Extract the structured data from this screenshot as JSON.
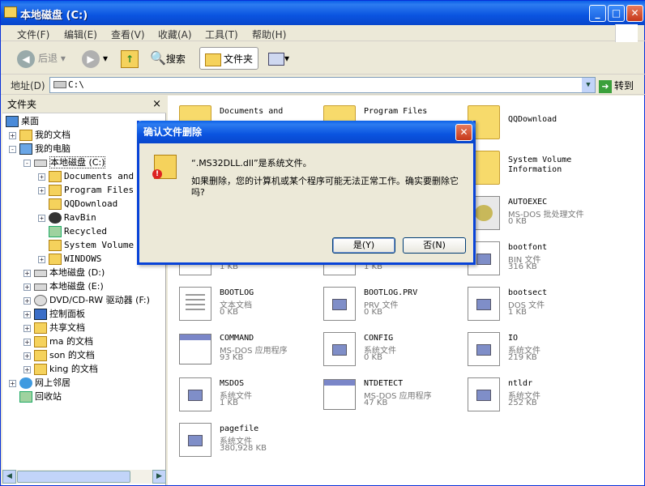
{
  "window": {
    "title": "本地磁盘 (C:)"
  },
  "menu": [
    "文件(F)",
    "编辑(E)",
    "查看(V)",
    "收藏(A)",
    "工具(T)",
    "帮助(H)"
  ],
  "toolbar": {
    "back": "后退",
    "search": "搜索",
    "folders": "文件夹"
  },
  "address": {
    "label": "地址(D)",
    "value": "C:\\",
    "go": "转到"
  },
  "pane": {
    "title": "文件夹",
    "close": "×"
  },
  "tree": [
    {
      "label": "桌面",
      "icon": "desktop-icon"
    },
    {
      "label": "我的文档",
      "icon": "folder-icon"
    },
    {
      "label": "我的电脑",
      "icon": "computer-icon"
    },
    {
      "label": "本地磁盘 (C:)",
      "icon": "drive-icon"
    },
    {
      "label": "Documents and",
      "icon": "folder-icon"
    },
    {
      "label": "Program Files",
      "icon": "folder-icon"
    },
    {
      "label": "QQDownload",
      "icon": "folder-icon"
    },
    {
      "label": "RavBin",
      "icon": "rav-icon"
    },
    {
      "label": "Recycled",
      "icon": "recycle-icon"
    },
    {
      "label": "System Volume",
      "icon": "folder-icon"
    },
    {
      "label": "WINDOWS",
      "icon": "folder-icon"
    },
    {
      "label": "本地磁盘 (D:)",
      "icon": "drive-icon"
    },
    {
      "label": "本地磁盘 (E:)",
      "icon": "drive-icon"
    },
    {
      "label": "DVD/CD-RW 驱动器 (F:)",
      "icon": "cd-icon"
    },
    {
      "label": "控制面板",
      "icon": "control-panel-icon"
    },
    {
      "label": "共享文档",
      "icon": "folder-icon"
    },
    {
      "label": "ma 的文档",
      "icon": "folder-icon"
    },
    {
      "label": "son 的文档",
      "icon": "folder-icon"
    },
    {
      "label": "king 的文档",
      "icon": "folder-icon"
    },
    {
      "label": "网上邻居",
      "icon": "network-icon"
    },
    {
      "label": "回收站",
      "icon": "recycle-bin-icon"
    }
  ],
  "files": [
    {
      "name": "Documents and",
      "type": "",
      "size": "",
      "icon": "folder"
    },
    {
      "name": "Program Files",
      "type": "",
      "size": "",
      "icon": "folder"
    },
    {
      "name": "QQDownload",
      "type": "",
      "size": "",
      "icon": "folder"
    },
    {
      "name": "System Volume",
      "type": "Information",
      "size": "",
      "icon": "folder"
    },
    {
      "name": "AUTOEXEC",
      "type": "MS-DOS 批处理文件",
      "size": "0 KB",
      "icon": "bat"
    },
    {
      "name": "bootfont",
      "type": "BIN 文件",
      "size": "316 KB",
      "icon": "sys"
    },
    {
      "name": "BOOTLOG",
      "type": "文本文档",
      "size": "0 KB",
      "icon": "doc"
    },
    {
      "name": "BOOTLOG.PRV",
      "type": "PRV 文件",
      "size": "0 KB",
      "icon": "sys"
    },
    {
      "name": "bootsect",
      "type": "DOS 文件",
      "size": "1 KB",
      "icon": "sys"
    },
    {
      "name": "COMMAND",
      "type": "MS-DOS 应用程序",
      "size": "93 KB",
      "icon": "app"
    },
    {
      "name": "CONFIG",
      "type": "系统文件",
      "size": "0 KB",
      "icon": "sys"
    },
    {
      "name": "IO",
      "type": "系统文件",
      "size": "219 KB",
      "icon": "sys"
    },
    {
      "name": "MSDOS",
      "type": "系统文件",
      "size": "1 KB",
      "icon": "sys"
    },
    {
      "name": "NTDETECT",
      "type": "MS-DOS 应用程序",
      "size": "47 KB",
      "icon": "app"
    },
    {
      "name": "ntldr",
      "type": "系统文件",
      "size": "252 KB",
      "icon": "sys"
    },
    {
      "name": "pagefile",
      "type": "系统文件",
      "size": "380,928 KB",
      "icon": "sys"
    }
  ],
  "hidden_sizes": [
    "1 KB",
    "1 KB"
  ],
  "dialog": {
    "title": "确认文件删除",
    "line1": "“.MS32DLL.dll”是系统文件。",
    "line2": "如果删除，您的计算机或某个程序可能无法正常工作。确实要删除它吗?",
    "yes": "是(Y)",
    "no": "否(N)"
  }
}
